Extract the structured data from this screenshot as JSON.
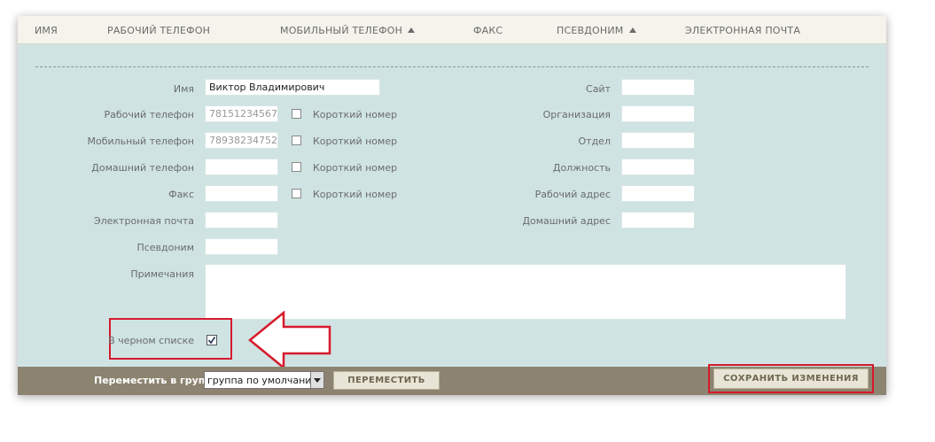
{
  "columns": {
    "name": "ИМЯ",
    "work_phone": "РАБОЧИЙ ТЕЛЕФОН",
    "mobile_phone": "МОБИЛЬНЫЙ ТЕЛЕФОН",
    "fax": "ФАКС",
    "alias": "ПСЕВДОНИМ",
    "email": "ЭЛЕКТРОННАЯ ПОЧТА"
  },
  "form": {
    "name_label": "Имя",
    "name_value": "Виктор Владимирович",
    "work_phone_label": "Рабочий телефон",
    "work_phone_value": "78151234567",
    "mobile_phone_label": "Мобильный телефон",
    "mobile_phone_value": "78938234752",
    "home_phone_label": "Домашний телефон",
    "home_phone_value": "",
    "fax_label": "Факс",
    "fax_value": "",
    "email_label": "Электронная почта",
    "email_value": "",
    "alias_label": "Псевдоним",
    "alias_value": "",
    "notes_label": "Примечания",
    "blacklist_label": "В черном списке",
    "blacklist_checked": true,
    "short_number_label": "Короткий номер",
    "site_label": "Сайт",
    "organization_label": "Организация",
    "department_label": "Отдел",
    "position_label": "Должность",
    "work_address_label": "Рабочий адрес",
    "home_address_label": "Домашний адрес"
  },
  "footer": {
    "move_to_group_label": "Переместить в группу",
    "group_selected": "группа по умолчанию",
    "move_button": "ПЕРЕМЕСТИТЬ",
    "save_button": "СОХРАНИТЬ ИЗМЕНЕНИЯ"
  },
  "colors": {
    "panel_bg": "#cfe3e3",
    "footer_bg": "#8c8470",
    "highlight": "#d7192c"
  }
}
